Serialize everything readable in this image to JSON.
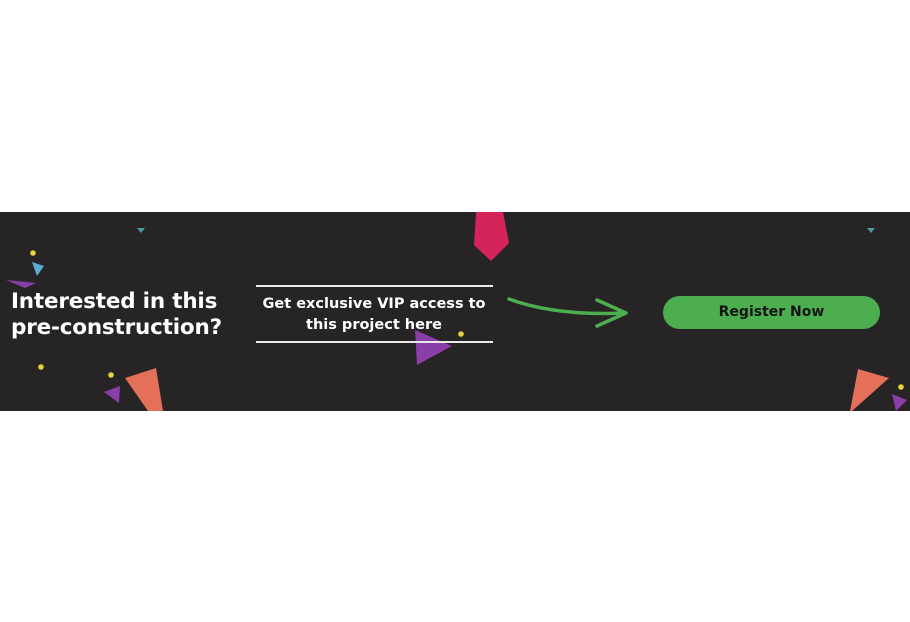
{
  "banner": {
    "headline_line1": "Interested in this",
    "headline_line2": "pre-construction?",
    "subtext_line1": "Get exclusive VIP access to",
    "subtext_line2": "this project here",
    "cta_label": "Register Now"
  },
  "colors": {
    "banner_background": "#262424",
    "cta_background": "#4cae4f",
    "arrow": "#4cae4f",
    "text": "#ffffff",
    "shard_pink": "#d4245a",
    "shard_salmon": "#e4705a",
    "shard_purple": "#8a3ea8",
    "shard_cyan": "#5aaed0",
    "confetti_dot": "#e6d23a"
  },
  "icons": {
    "arrow": "curved-arrow-icon",
    "decorations": "geometric-confetti"
  }
}
